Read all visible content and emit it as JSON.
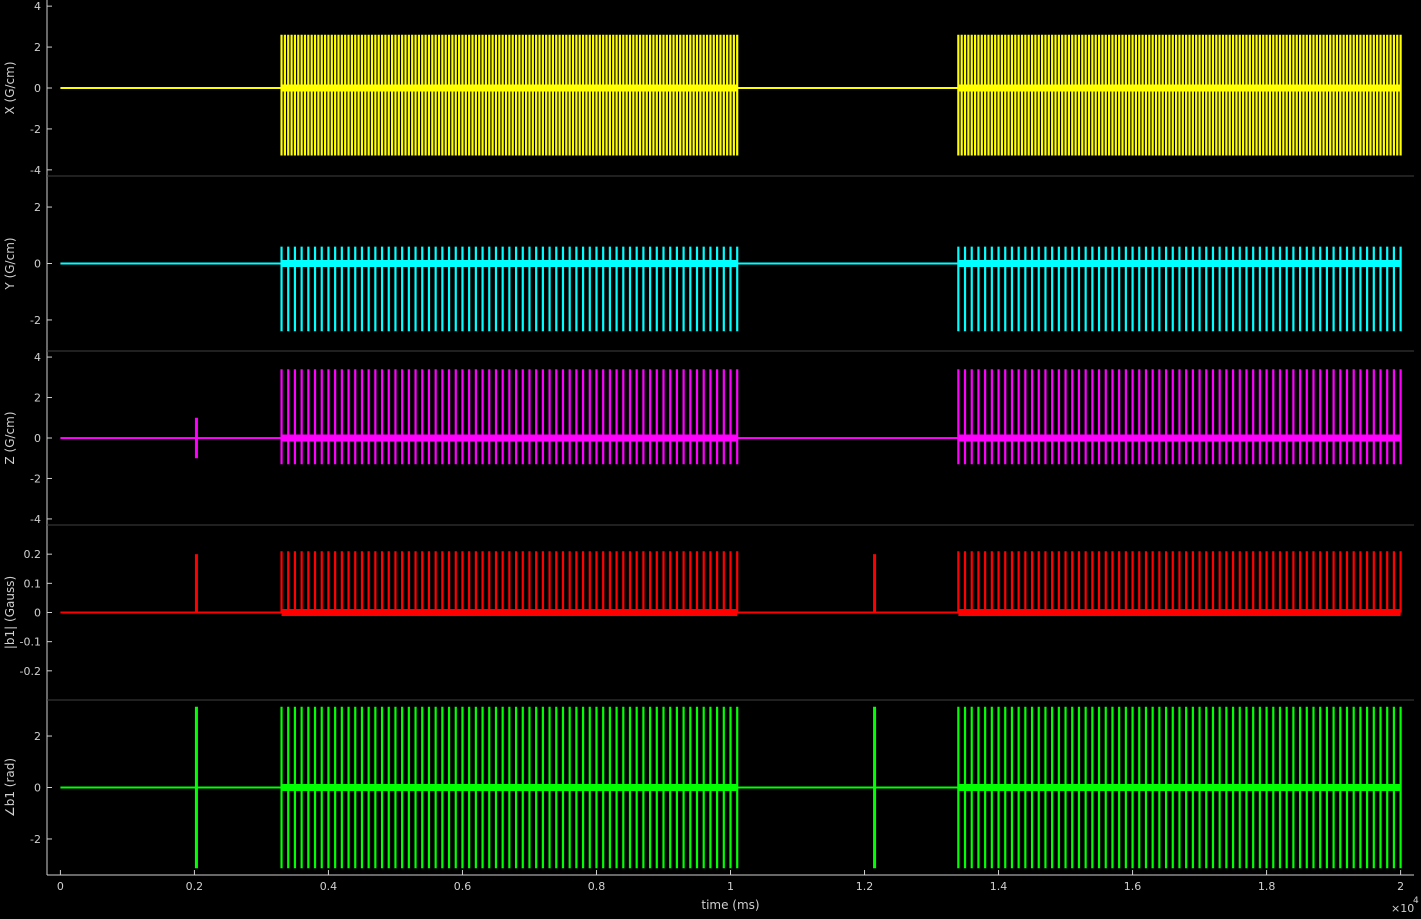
{
  "figure": {
    "background": "#000000",
    "axis_color": "#d0d0d0",
    "divider_color": "#404040"
  },
  "chart_data": [
    {
      "type": "line",
      "name": "x-gradient",
      "ylabel": "X (G/cm)",
      "color": "#ffff00",
      "ylim": [
        -4.3,
        4.3
      ],
      "yticks": [
        -4,
        -2,
        0,
        2,
        4
      ],
      "ytick_labels": [
        "-4",
        "-2",
        "0",
        "2",
        "4"
      ],
      "waveform": {
        "baseline": 0,
        "max": 2.6,
        "min": -3.3,
        "pulse_pitch_ms": 50,
        "bursts_ms": [
          [
            3300,
            10100
          ],
          [
            13400,
            20000
          ]
        ],
        "spikes_ms": []
      }
    },
    {
      "type": "line",
      "name": "y-gradient",
      "ylabel": "Y (G/cm)",
      "color": "#00ffff",
      "ylim": [
        -3.1,
        3.1
      ],
      "yticks": [
        -2,
        0,
        2
      ],
      "ytick_labels": [
        "-2",
        "0",
        "2"
      ],
      "waveform": {
        "baseline": 0,
        "max": 0.6,
        "min": -2.4,
        "pulse_pitch_ms": 100,
        "bursts_ms": [
          [
            3300,
            10100
          ],
          [
            13400,
            20000
          ]
        ],
        "spikes_ms": []
      }
    },
    {
      "type": "line",
      "name": "z-gradient",
      "ylabel": "Z (G/cm)",
      "color": "#ff00ff",
      "ylim": [
        -4.3,
        4.3
      ],
      "yticks": [
        -4,
        -2,
        0,
        2,
        4
      ],
      "ytick_labels": [
        "-4",
        "-2",
        "0",
        "2",
        "4"
      ],
      "waveform": {
        "baseline": 0,
        "max": 3.4,
        "min": -1.3,
        "pulse_pitch_ms": 100,
        "bursts_ms": [
          [
            3300,
            10100
          ],
          [
            13400,
            20000
          ]
        ],
        "spikes_ms": [
          [
            2030,
            1.0,
            -1.0
          ]
        ]
      }
    },
    {
      "type": "line",
      "name": "b1-magnitude",
      "ylabel": "|b1| (Gauss)",
      "color": "#ff0000",
      "ylim": [
        -0.3,
        0.3
      ],
      "yticks": [
        -0.2,
        -0.1,
        0,
        0.1,
        0.2
      ],
      "ytick_labels": [
        "-0.2",
        "-0.1",
        "0",
        "0.1",
        "0.2"
      ],
      "waveform": {
        "baseline": 0,
        "max": 0.21,
        "min": 0,
        "pulse_pitch_ms": 100,
        "bursts_ms": [
          [
            3300,
            10100
          ],
          [
            13400,
            20000
          ]
        ],
        "spikes_ms": [
          [
            2030,
            0.2,
            0
          ],
          [
            12150,
            0.2,
            0
          ]
        ]
      }
    },
    {
      "type": "line",
      "name": "b1-phase",
      "ylabel": "∠b1 (rad)",
      "color": "#00ff00",
      "ylim": [
        -3.4,
        3.4
      ],
      "yticks": [
        -2,
        0,
        2
      ],
      "ytick_labels": [
        "-2",
        "0",
        "2"
      ],
      "waveform": {
        "baseline": 0,
        "max": 3.14,
        "min": -3.14,
        "pulse_pitch_ms": 100,
        "bursts_ms": [
          [
            3300,
            10100
          ],
          [
            13400,
            20000
          ]
        ],
        "spikes_ms": [
          [
            2030,
            3.14,
            -3.14
          ],
          [
            12150,
            3.14,
            -3.14
          ]
        ]
      }
    }
  ],
  "x_axis": {
    "label": "time (ms)",
    "exponent_label": "×10",
    "exponent_power": "4",
    "xlim": [
      -200,
      20200
    ],
    "ticks": [
      0,
      2000,
      4000,
      6000,
      8000,
      10000,
      12000,
      14000,
      16000,
      18000,
      20000
    ],
    "tick_labels": [
      "0",
      "0.2",
      "0.4",
      "0.6",
      "0.8",
      "1",
      "1.2",
      "1.4",
      "1.6",
      "1.8",
      "2"
    ]
  }
}
